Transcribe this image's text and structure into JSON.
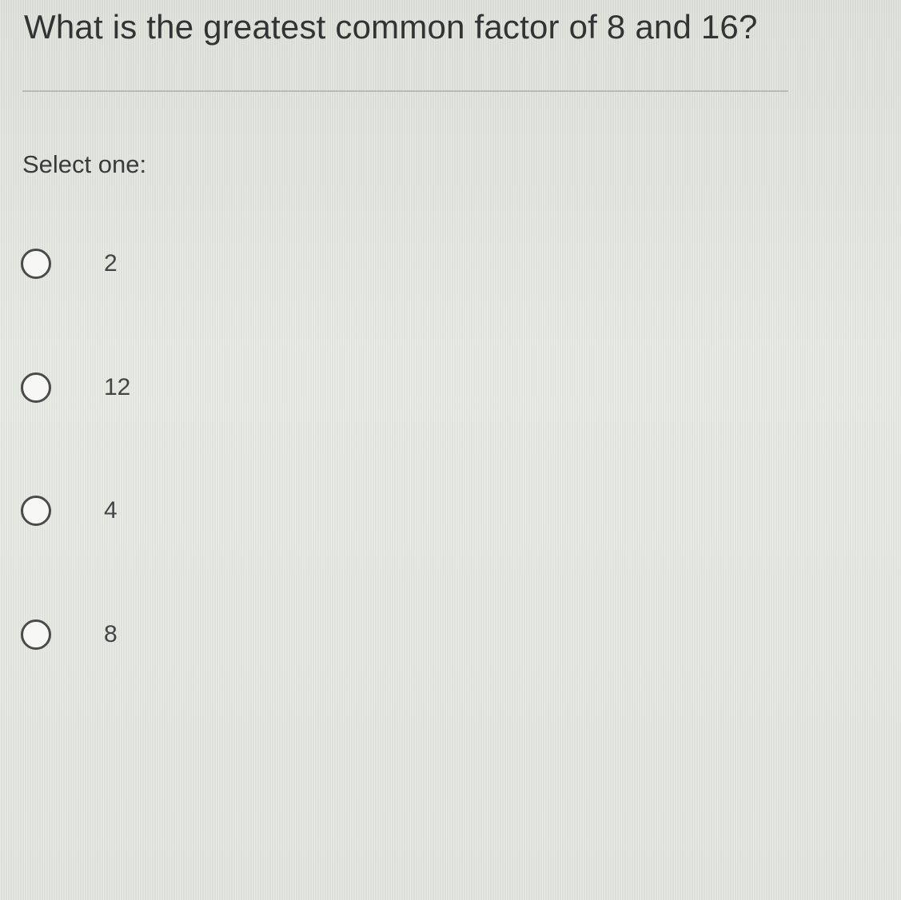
{
  "question": {
    "text": "What is the greatest common factor of 8 and 16?"
  },
  "prompt": "Select one:",
  "options": [
    {
      "label": "2",
      "selected": false
    },
    {
      "label": "12",
      "selected": false
    },
    {
      "label": "4",
      "selected": false
    },
    {
      "label": "8",
      "selected": false
    }
  ],
  "colors": {
    "background": "#e6e8e2",
    "text": "#333333",
    "divider": "#b9bcb6",
    "radio_border": "#4a4a4a"
  }
}
